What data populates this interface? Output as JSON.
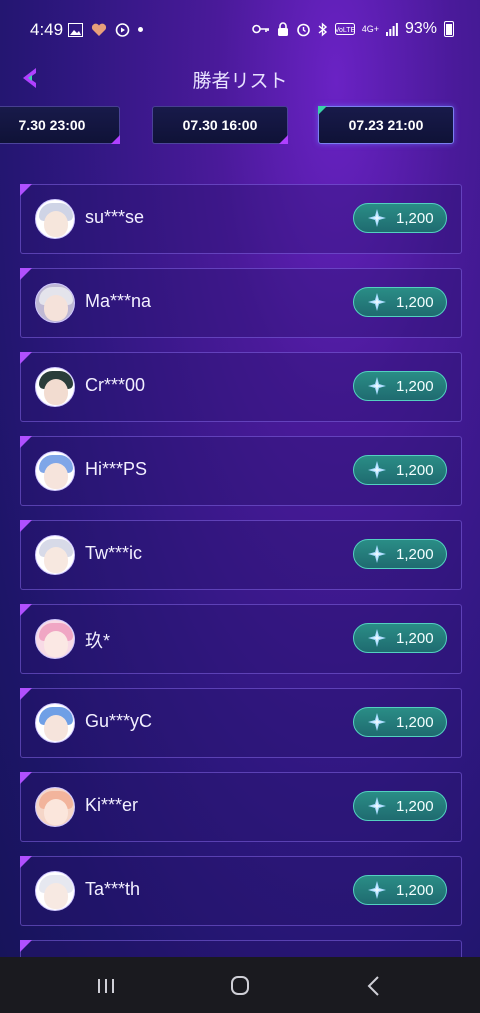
{
  "status": {
    "time": "4:49",
    "battery_text": "93%",
    "network": "4G+"
  },
  "header": {
    "title": "勝者リスト"
  },
  "tabs": [
    {
      "label": "7.30 23:00"
    },
    {
      "label": "07.30 16:00"
    },
    {
      "label": "07.23 21:00"
    }
  ],
  "selected_tab": 2,
  "winners": [
    {
      "name": "su***se",
      "amount": "1,200"
    },
    {
      "name": "Ma***na",
      "amount": "1,200"
    },
    {
      "name": "Cr***00",
      "amount": "1,200"
    },
    {
      "name": "Hi***PS",
      "amount": "1,200"
    },
    {
      "name": "Tw***ic",
      "amount": "1,200"
    },
    {
      "name": "玖*",
      "amount": "1,200"
    },
    {
      "name": "Gu***yC",
      "amount": "1,200"
    },
    {
      "name": "Ki***er",
      "amount": "1,200"
    },
    {
      "name": "Ta***th",
      "amount": "1,200"
    }
  ],
  "colors": {
    "accent_purple": "#b050ff",
    "reward_teal": "#2a8d86",
    "gem": "#9fd4ff"
  },
  "icons": {
    "back": "back-arrow-icon",
    "gem": "primogem-icon",
    "nav_recent": "recent-apps-icon",
    "nav_home": "home-icon",
    "nav_back": "back-icon"
  }
}
